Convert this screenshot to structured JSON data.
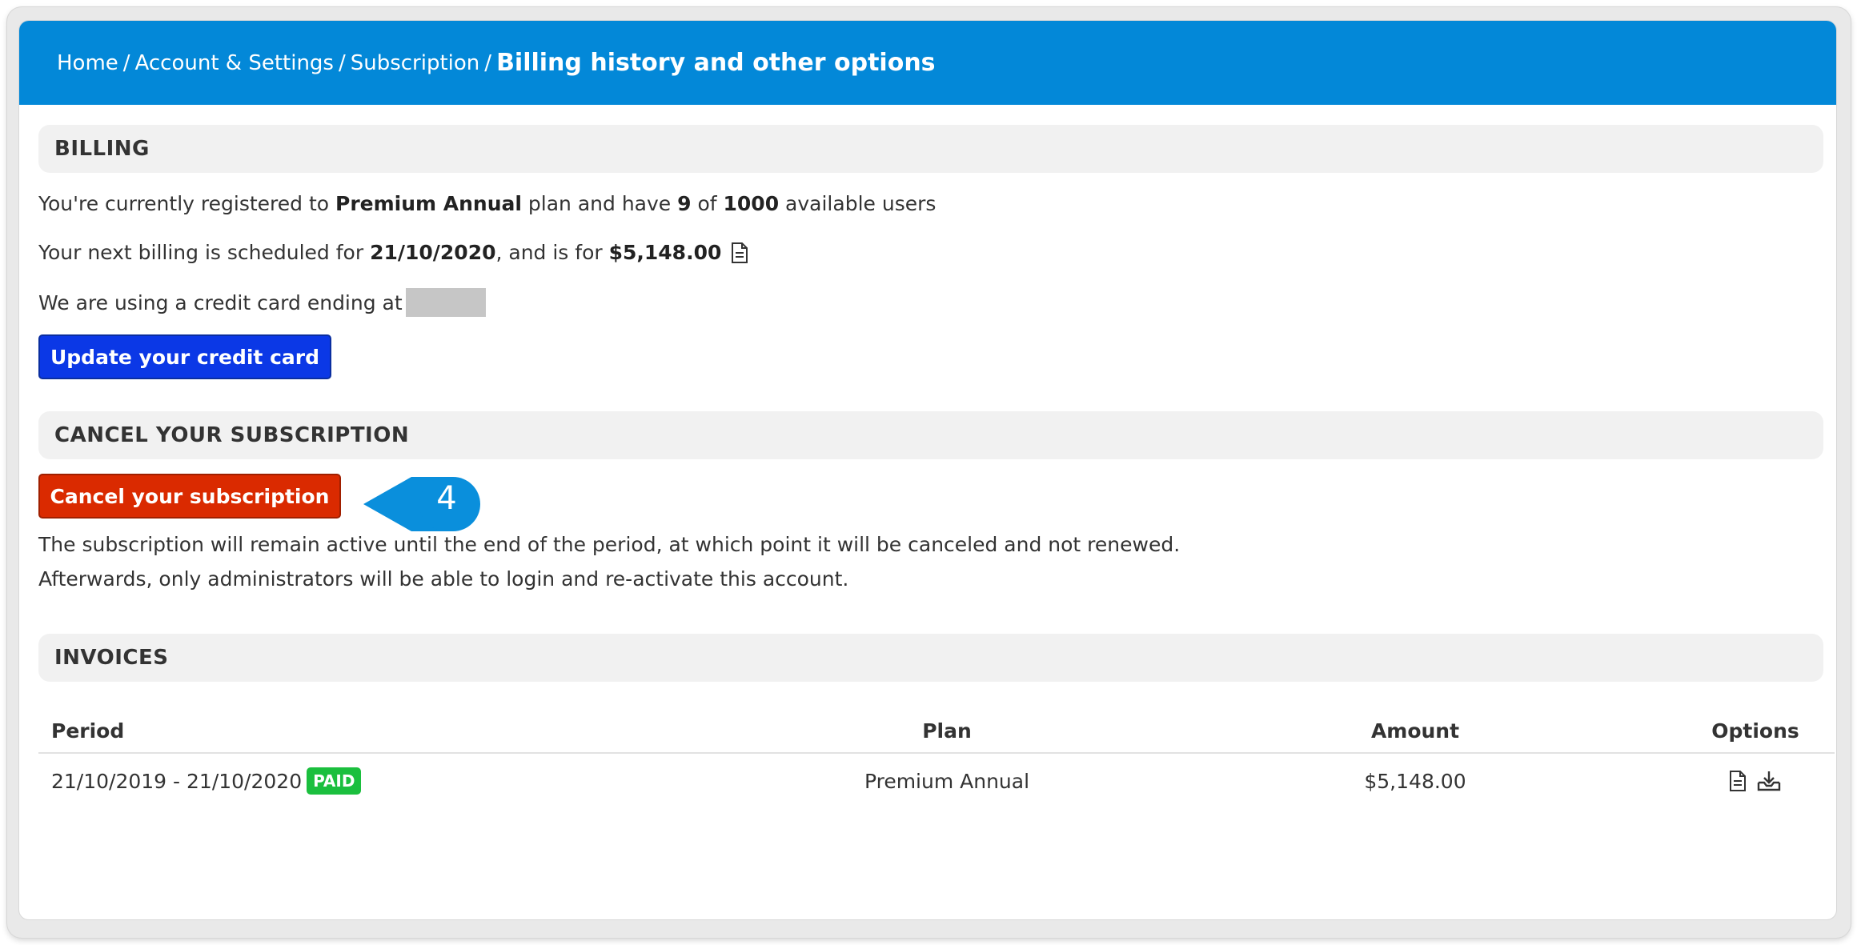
{
  "breadcrumb": {
    "home": "Home",
    "account": "Account & Settings",
    "subscription": "Subscription",
    "current": "Billing history and other options",
    "separator": "/"
  },
  "billing": {
    "heading": "BILLING",
    "plan_prefix": "You're currently registered to ",
    "plan_name": "Premium Annual",
    "plan_mid": " plan and have ",
    "users_used": "9",
    "users_of": " of ",
    "users_total": "1000",
    "users_suffix": " available users",
    "next_prefix": "Your next billing is scheduled for ",
    "next_date": "21/10/2020",
    "next_mid": ", and is for ",
    "next_amount": "$5,148.00",
    "card_text": "We are using a credit card ending at",
    "update_button": "Update your credit card"
  },
  "cancel": {
    "heading": "CANCEL YOUR SUBSCRIPTION",
    "button": "Cancel your subscription",
    "callout_number": "4",
    "note_line1": "The subscription will remain active until the end of the period, at which point it will be canceled and not renewed.",
    "note_line2": "Afterwards, only administrators will be able to login and re-activate this account."
  },
  "invoices": {
    "heading": "INVOICES",
    "columns": [
      "Period",
      "Plan",
      "Amount",
      "Options"
    ],
    "rows": [
      {
        "period": "21/10/2019 - 21/10/2020",
        "status": "PAID",
        "plan": "Premium Annual",
        "amount": "$5,148.00",
        "options": [
          "document-icon",
          "download-icon"
        ]
      }
    ]
  },
  "colors": {
    "header": "#0388d8",
    "update_button": "#0b38e6",
    "cancel_button": "#da2a00",
    "paid_badge": "#1bbf3e",
    "callout": "#0a8fdc"
  }
}
